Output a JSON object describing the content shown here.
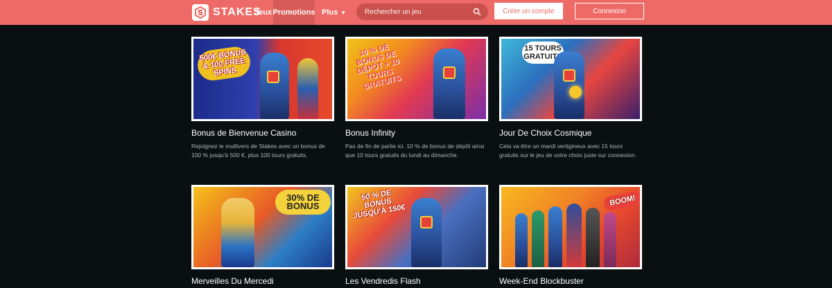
{
  "brand": {
    "name": "STAKES",
    "primary_color": "#ee6a66"
  },
  "nav": {
    "items": [
      {
        "label": "Jeux"
      },
      {
        "label": "Promotions"
      },
      {
        "label": "Plus"
      }
    ]
  },
  "search": {
    "placeholder": "Rechercher un jeu"
  },
  "auth": {
    "create_label": "Créer un compte",
    "login_label": "Connexion"
  },
  "promotions": [
    {
      "title": "Bonus de Bienvenue Casino",
      "description": "Rejoignez le multivers de Stakes avec un bonus de 100 % jusqu'à 500 €, plus 100 tours gratuits.",
      "art_text": "500€ BONUS & 100 FREE SPINS"
    },
    {
      "title": "Bonus Infinity",
      "description": "Pas de fin de partie ici. 10 % de bonus de dépôt ainsi que 10 tours gratuits du lundi au dimanche.",
      "art_text": "10 % DE BONUS DE DÉPÔT + 10 TOURS GRATUITS"
    },
    {
      "title": "Jour De Choix Cosmique",
      "description": "Cela va être un mardi vertigineux avec 15 tours gratuits sur le jeu de votre choix juste sur connexion.",
      "art_text": "15 TOURS GRATUITS"
    },
    {
      "title": "Merveilles Du Mercedi",
      "description": "",
      "art_text": "30% DE BONUS"
    },
    {
      "title": "Les Vendredis Flash",
      "description": "",
      "art_text": "50 % DE BONUS JUSQU'À 150€"
    },
    {
      "title": "Week-End Blockbuster",
      "description": "",
      "art_text": "BOOM!"
    }
  ]
}
